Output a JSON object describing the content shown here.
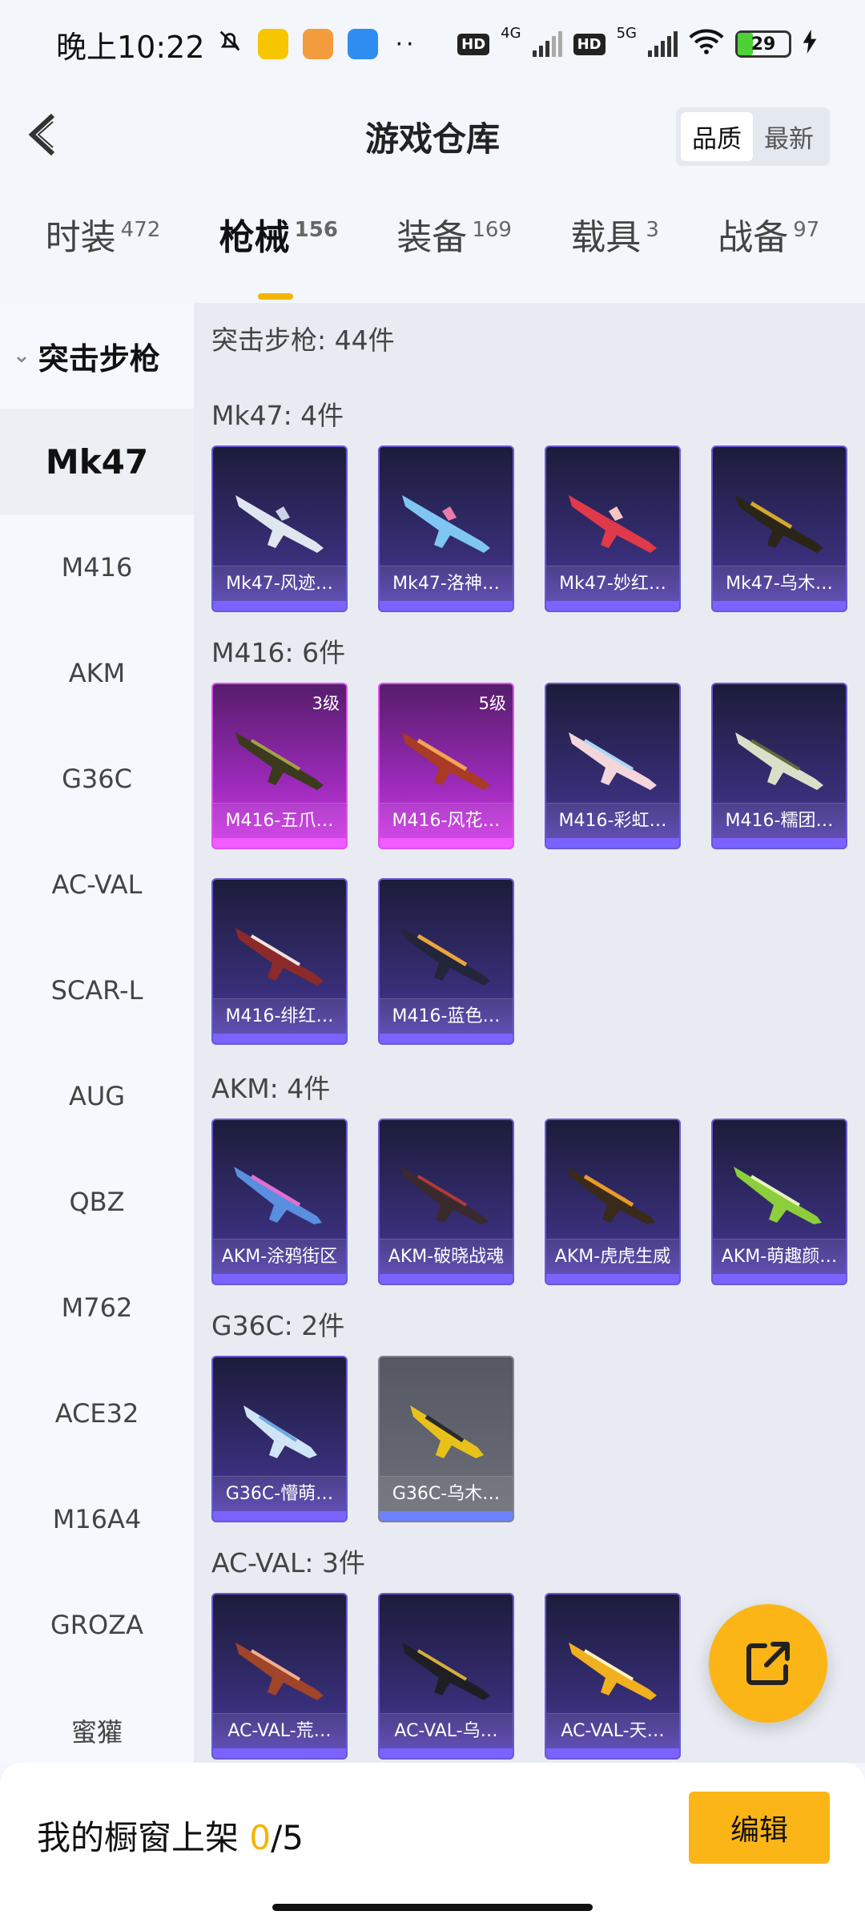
{
  "status_bar": {
    "time": "晚上10:22",
    "dots": "··",
    "hd1": "HD",
    "net1": "4G",
    "hd2": "HD",
    "net2": "5G",
    "battery": "29"
  },
  "header": {
    "title": "游戏仓库",
    "sort_quality": "品质",
    "sort_newest": "最新"
  },
  "tabs": [
    {
      "label": "时装",
      "count": "472"
    },
    {
      "label": "枪械",
      "count": "156"
    },
    {
      "label": "装备",
      "count": "169"
    },
    {
      "label": "载具",
      "count": "3"
    },
    {
      "label": "战备",
      "count": "97"
    }
  ],
  "sidebar": {
    "category": "突击步枪",
    "items": [
      "Mk47",
      "M416",
      "AKM",
      "G36C",
      "AC-VAL",
      "SCAR-L",
      "AUG",
      "QBZ",
      "M762",
      "ACE32",
      "M16A4",
      "GROZA",
      "蜜獾"
    ]
  },
  "main": {
    "category_header": "突击步枪: 44件",
    "sections": [
      {
        "title": "Mk47: 4件",
        "cards": [
          {
            "name": "Mk47-风迹…",
            "level": ""
          },
          {
            "name": "Mk47-洛神…",
            "level": ""
          },
          {
            "name": "Mk47-妙红…",
            "level": ""
          },
          {
            "name": "Mk47-乌木…",
            "level": ""
          }
        ]
      },
      {
        "title": "M416: 6件",
        "cards": [
          {
            "name": "M416-五爪…",
            "level": "3级"
          },
          {
            "name": "M416-风花…",
            "level": "5级"
          },
          {
            "name": "M416-彩虹…",
            "level": ""
          },
          {
            "name": "M416-糯团…",
            "level": ""
          },
          {
            "name": "M416-绯红…",
            "level": ""
          },
          {
            "name": "M416-蓝色…",
            "level": ""
          }
        ]
      },
      {
        "title": "AKM: 4件",
        "cards": [
          {
            "name": "AKM-涂鸦街区",
            "level": ""
          },
          {
            "name": "AKM-破晓战魂",
            "level": ""
          },
          {
            "name": "AKM-虎虎生威",
            "level": ""
          },
          {
            "name": "AKM-萌趣颜…",
            "level": ""
          }
        ]
      },
      {
        "title": "G36C: 2件",
        "cards": [
          {
            "name": "G36C-懵萌…",
            "level": ""
          },
          {
            "name": "G36C-乌木…",
            "level": ""
          }
        ]
      },
      {
        "title": "AC-VAL: 3件",
        "cards": [
          {
            "name": "AC-VAL-荒…",
            "level": ""
          },
          {
            "name": "AC-VAL-乌…",
            "level": ""
          },
          {
            "name": "AC-VAL-天…",
            "level": ""
          }
        ]
      }
    ]
  },
  "bottom_bar": {
    "label": "我的橱窗上架",
    "current": "0",
    "total": "/5",
    "edit_button": "编辑"
  },
  "colors": {
    "accent": "#fbb516",
    "card_blue": "#3a2f7b",
    "card_purple": "#9a2ab8",
    "card_gray": "#6d707a"
  }
}
